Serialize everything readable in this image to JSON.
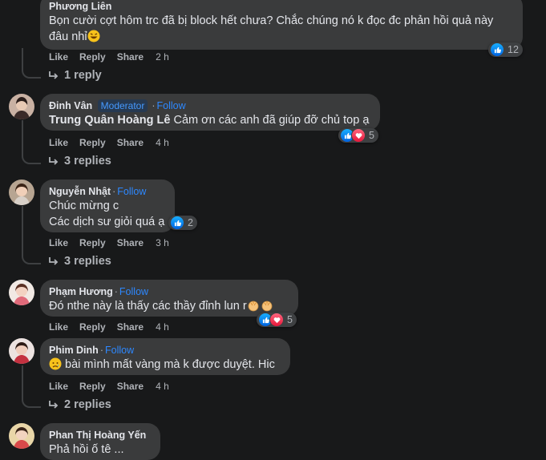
{
  "comments": [
    {
      "author": "Phương Liên",
      "text_line1": "Bọn cười cợt hôm trc đã bị block hết chưa? Chắc chúng nó k đọc đc phản hồi quả này",
      "text_line2": "đâu nhỉ",
      "actions": {
        "like": "Like",
        "reply": "Reply",
        "share": "Share",
        "time": "2 h"
      },
      "reaction_count": "12",
      "replies": "1 reply"
    },
    {
      "author": "Đinh Vân",
      "badge": "Moderator",
      "follow": "Follow",
      "mention": "Trung Quân Hoàng Lê",
      "text": "Cảm ơn các anh đã giúp đỡ chủ top ạ",
      "actions": {
        "like": "Like",
        "reply": "Reply",
        "share": "Share",
        "time": "4 h"
      },
      "reaction_count": "5",
      "replies": "3 replies"
    },
    {
      "author": "Nguyễn Nhật",
      "follow": "Follow",
      "text_line1": "Chúc mừng c",
      "text_line2": "Các dịch sư giỏi quá ạ",
      "actions": {
        "like": "Like",
        "reply": "Reply",
        "share": "Share",
        "time": "3 h"
      },
      "reaction_count": "2",
      "replies": "3 replies"
    },
    {
      "author": "Phạm Hương",
      "follow": "Follow",
      "text": "Đó nthe này là thấy các thầy đỉnh lun r",
      "actions": {
        "like": "Like",
        "reply": "Reply",
        "share": "Share",
        "time": "4 h"
      },
      "reaction_count": "5"
    },
    {
      "author": "Phim Dinh",
      "follow": "Follow",
      "text": "bài mình mất vàng mà k được duyệt. Hic",
      "actions": {
        "like": "Like",
        "reply": "Reply",
        "share": "Share",
        "time": "4 h"
      },
      "replies": "2 replies"
    },
    {
      "author": "Phan Thị Hoàng Yến",
      "text_partial": "Phả  hồi  ố  tê  ..."
    }
  ],
  "dot": "·"
}
